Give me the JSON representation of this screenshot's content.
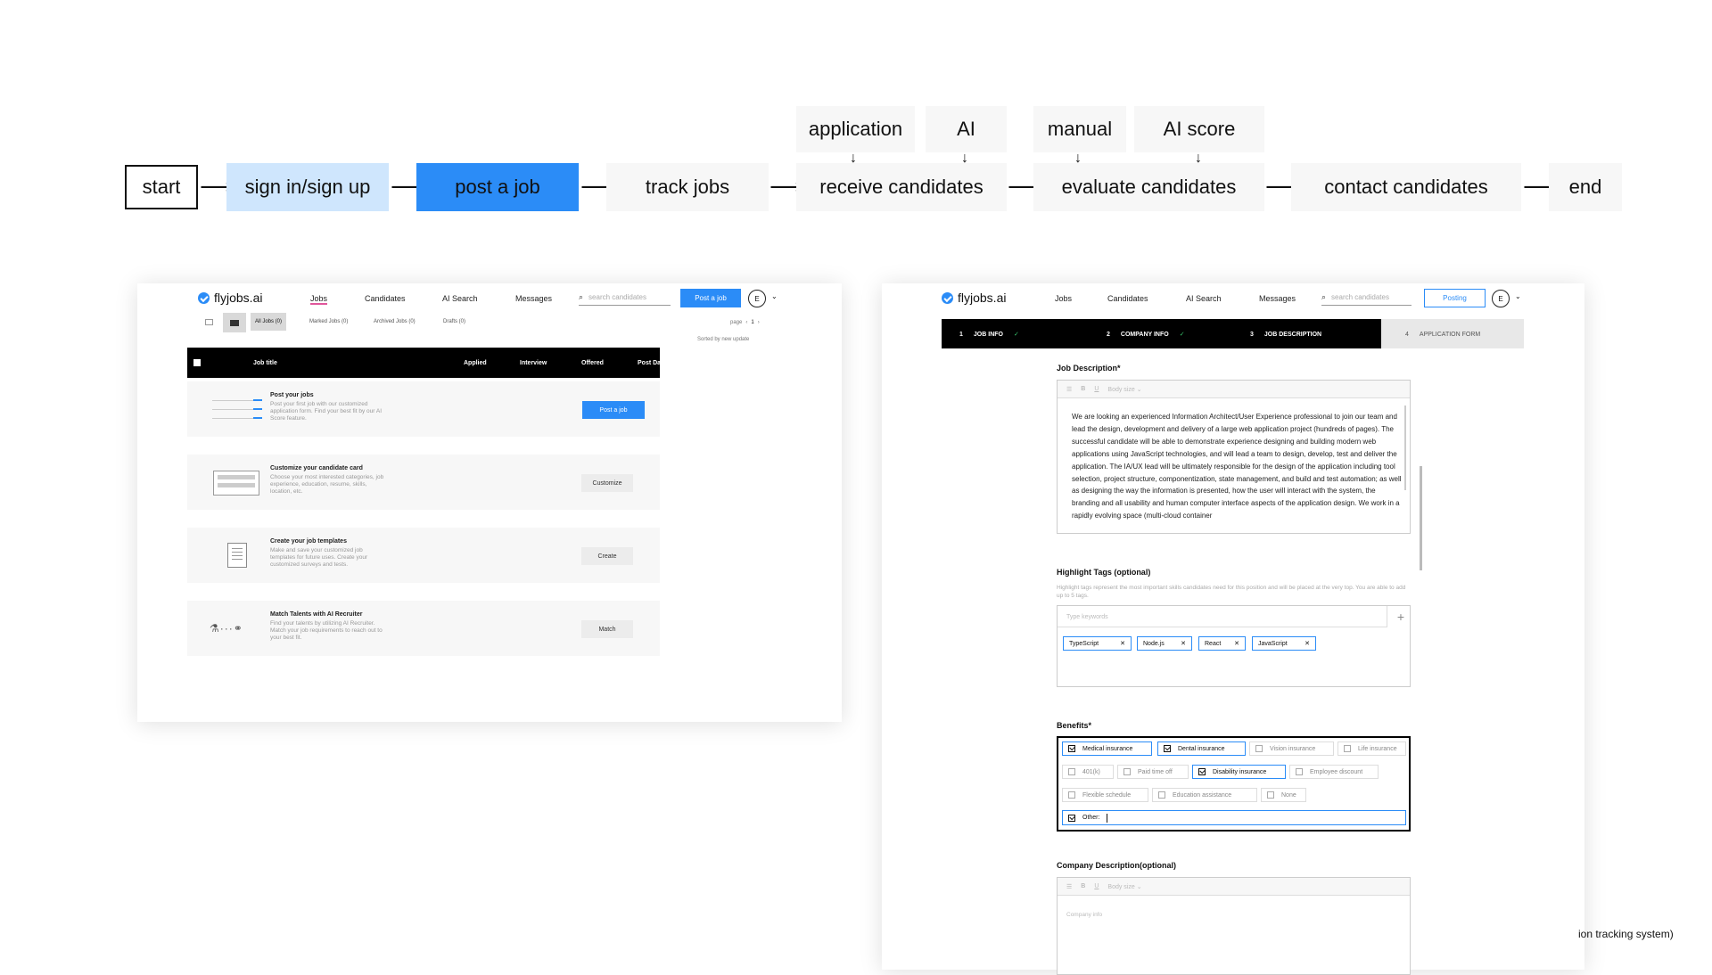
{
  "flow": {
    "steps": [
      "start",
      "sign in/sign up",
      "post a job",
      "track jobs",
      "receive candidates",
      "evaluate candidates",
      "contact candidates",
      "end"
    ],
    "sources": [
      "application",
      "AI",
      "manual",
      "AI score"
    ]
  },
  "dashboard": {
    "brand": "flyjobs.ai",
    "nav": [
      "Jobs",
      "Candidates",
      "AI Search",
      "Messages"
    ],
    "search_placeholder": "search candidates",
    "post_button": "Post a job",
    "avatar": "E",
    "tabs": [
      "All Jobs (0)",
      "Marked Jobs (0)",
      "Archived Jobs (0)",
      "Drafts (0)"
    ],
    "page_label": "page",
    "page_num": "1",
    "sort_label": "Sorted by new update",
    "columns": [
      "Job title",
      "Applied",
      "Interview",
      "Offered",
      "Post Date"
    ],
    "cards": [
      {
        "title": "Post your jobs",
        "desc": "Post your first job with our customized application form. Find your best fit by our AI Score feature.",
        "button": "Post a job"
      },
      {
        "title": "Customize your candidate card",
        "desc": "Choose your most interested categories, job experience, education, resume, skills, location, etc.",
        "button": "Customize"
      },
      {
        "title": "Create your job templates",
        "desc": "Make and save your customized job templates for future uses. Create your customized surveys and tests.",
        "button": "Create"
      },
      {
        "title": "Match Talents with AI Recruiter",
        "desc": "Find your talents by utilizing AI Recruiter. Match your job requirements to reach out to your best fit.",
        "button": "Match"
      }
    ]
  },
  "posting": {
    "brand": "flyjobs.ai",
    "nav": [
      "Jobs",
      "Candidates",
      "AI Search",
      "Messages"
    ],
    "search_placeholder": "search candidates",
    "button": "Posting",
    "avatar": "E",
    "steps": [
      {
        "num": "1",
        "label": "JOB INFO",
        "done": true
      },
      {
        "num": "2",
        "label": "COMPANY INFO",
        "done": true
      },
      {
        "num": "3",
        "label": "JOB DESCRIPTION",
        "done": false
      },
      {
        "num": "4",
        "label": "APPLICATION FORM",
        "done": false
      }
    ],
    "job_desc_label": "Job Description*",
    "toolbar_size": "Body size",
    "job_desc_text": "We are looking an experienced Information Architect/User Experience professional to join our team and lead the design, development and delivery of a large web application project (hundreds of pages). The successful candidate will be able to demonstrate experience designing and building modern web applications using JavaScript technologies, and will lead a team to design, develop, test and deliver the application. The IA/UX lead will be ultimately responsible for the design of the application including tool selection, project structure, componentization, state management, and build and test automation; as well as designing the way the information is presented, how the user will interact with the system, the branding and all usability and human computer interface aspects of the application design. We work in a rapidly evolving space (multi-cloud container",
    "tags_label": "Highlight Tags (optional)",
    "tags_hint": "Highlight tags represent the most important skills candidates need for this position and will be placed at the very top. You are able to add up to 5 tags.",
    "tags_placeholder": "Type keywords",
    "tags": [
      "TypeScript",
      "Node.js",
      "React",
      "JavaScript"
    ],
    "benefits_label": "Benefits*",
    "benefits": [
      {
        "label": "Medical insurance",
        "checked": true
      },
      {
        "label": "Dental insurance",
        "checked": true
      },
      {
        "label": "Vision insurance",
        "checked": false
      },
      {
        "label": "Life insurance",
        "checked": false
      },
      {
        "label": "401(k)",
        "checked": false
      },
      {
        "label": "Paid time off",
        "checked": false
      },
      {
        "label": "Disability insurance",
        "checked": true
      },
      {
        "label": "Employee discount",
        "checked": false
      },
      {
        "label": "Flexible schedule",
        "checked": false
      },
      {
        "label": "Education assistance",
        "checked": false
      },
      {
        "label": "None",
        "checked": false
      }
    ],
    "other_label": "Other:",
    "company_desc_label": "Company Description(optional)",
    "company_placeholder": "Company info"
  },
  "caption_fragment": "ion tracking system)",
  "colors": {
    "accent": "#2b8cf7",
    "light_accent": "#cfe6fd",
    "dark": "#000000"
  }
}
